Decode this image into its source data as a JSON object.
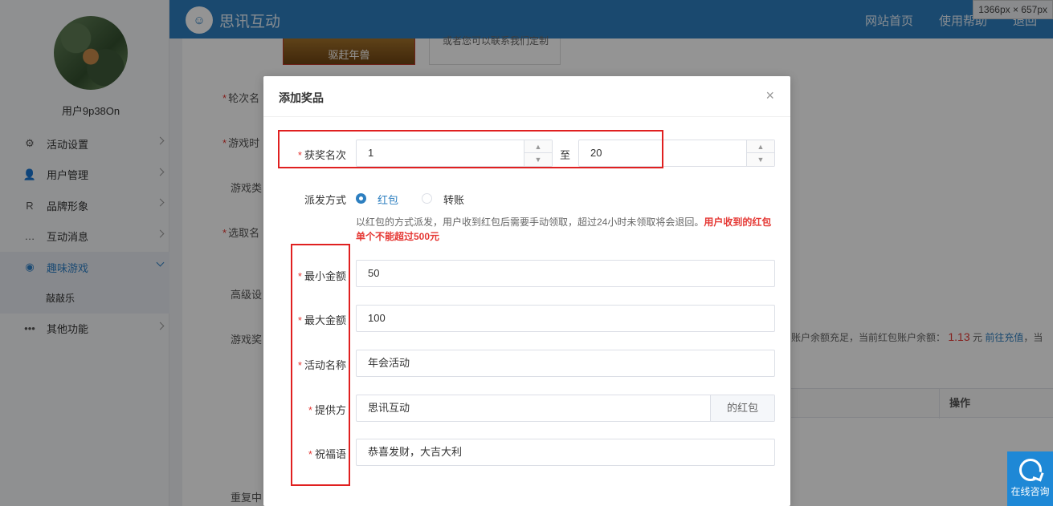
{
  "header": {
    "brand": "思讯互动",
    "logo_glyph": "☺",
    "nav": [
      "网站首页",
      "使用帮助",
      "退回"
    ],
    "dims": "1366px × 657px"
  },
  "sidebar": {
    "username": "用户9p38On",
    "items": [
      {
        "label": "活动设置",
        "icon": "gear-icon",
        "glyph": "⚙"
      },
      {
        "label": "用户管理",
        "icon": "user-icon",
        "glyph": "👤"
      },
      {
        "label": "品牌形象",
        "icon": "r-icon",
        "glyph": "R"
      },
      {
        "label": "互动消息",
        "icon": "message-icon",
        "glyph": "…"
      },
      {
        "label": "趣味游戏",
        "icon": "game-icon",
        "glyph": "◉"
      }
    ],
    "sub_item": "敲敲乐",
    "other": {
      "label": "其他功能",
      "glyph": "•••"
    }
  },
  "background": {
    "game_name": "驱赶年兽",
    "contact": "或者您可以联系我们定制",
    "labels": [
      "轮次名",
      "游戏时",
      "游戏类",
      "选取名",
      "高级设",
      "游戏奖",
      "重复中"
    ],
    "note_prefix": "账户余额充足，当前红包账户余额：",
    "note_amount": "1.13",
    "note_unit": "元",
    "note_link": "前往充值",
    "note_suffix": "，当",
    "table_op": "操作"
  },
  "modal": {
    "title": "添加奖品",
    "close": "×",
    "rank_label": "获奖名次",
    "rank_from": "1",
    "rank_sep": "至",
    "rank_to": "20",
    "method_label": "派发方式",
    "method_options": [
      "红包",
      "转账"
    ],
    "hint_text": "以红包的方式派发，用户收到红包后需要手动领取，超过24小时未领取将会退回。",
    "hint_bold": "用户收到的红包单个不能超过500元",
    "min_label": "最小金额",
    "min_value": "50",
    "max_label": "最大金额",
    "max_value": "100",
    "name_label": "活动名称",
    "name_value": "年会活动",
    "provider_label": "提供方",
    "provider_value": "思讯互动",
    "provider_suffix": "的红包",
    "bless_label": "祝福语",
    "bless_value": "恭喜发财，大吉大利"
  },
  "consult": {
    "label": "在线咨询"
  },
  "colors": {
    "header": "#2d7fc0",
    "accent": "#2d7fc0",
    "highlight": "#e02020"
  }
}
